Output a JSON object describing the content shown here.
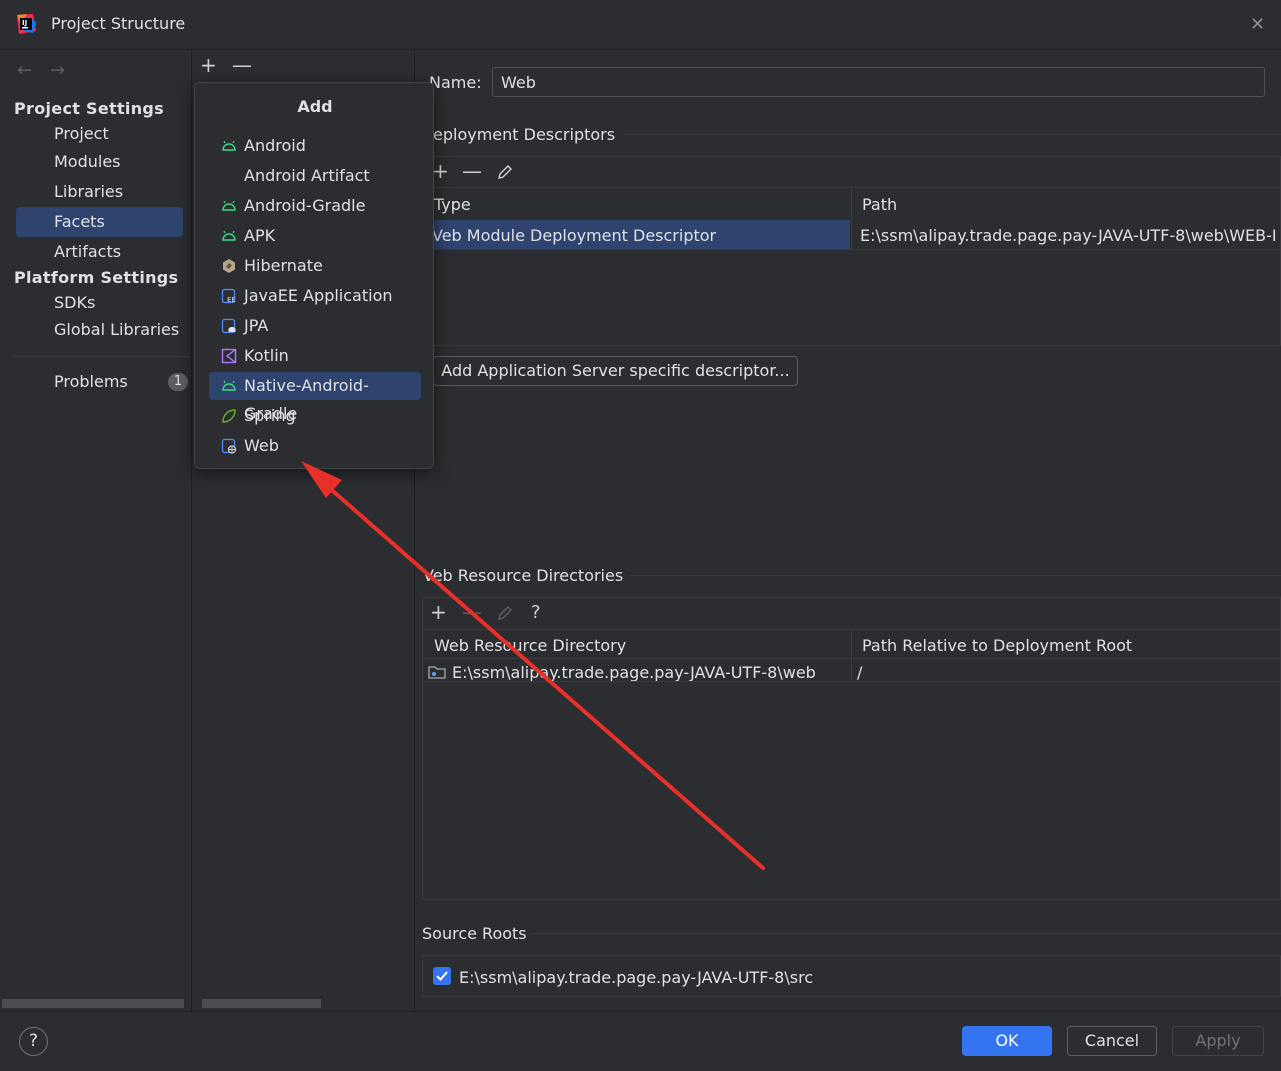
{
  "window": {
    "title": "Project Structure"
  },
  "sidebar": {
    "project_settings_label": "Project Settings",
    "project_items": [
      "Project",
      "Modules",
      "Libraries",
      "Facets",
      "Artifacts"
    ],
    "platform_settings_label": "Platform Settings",
    "platform_items": [
      "SDKs",
      "Global Libraries"
    ],
    "problems_label": "Problems",
    "problems_count": "1"
  },
  "popup": {
    "title": "Add",
    "items": [
      {
        "label": "Android",
        "icon": "android-icon"
      },
      {
        "label": "Android Artifact",
        "icon": ""
      },
      {
        "label": "Android-Gradle",
        "icon": "android-icon"
      },
      {
        "label": "APK",
        "icon": "android-icon"
      },
      {
        "label": "Hibernate",
        "icon": "hibernate-icon"
      },
      {
        "label": "JavaEE Application",
        "icon": "javaee-icon"
      },
      {
        "label": "JPA",
        "icon": "jpa-icon"
      },
      {
        "label": "Kotlin",
        "icon": "kotlin-icon"
      },
      {
        "label": "Native-Android-Gradle",
        "icon": "android-icon"
      },
      {
        "label": "Spring",
        "icon": "spring-icon"
      },
      {
        "label": "Web",
        "icon": "web-icon"
      }
    ],
    "selected": "Native-Android-Gradle"
  },
  "main": {
    "name_label": "Name:",
    "name_value": "Web",
    "deployment_title": "eployment Descriptors",
    "deployment_columns": [
      "Type",
      "Path"
    ],
    "deployment_row": {
      "type": "Veb Module Deployment Descriptor",
      "path": "E:\\ssm\\alipay.trade.page.pay-JAVA-UTF-8\\web\\WEB-I"
    },
    "add_server_button": "Add Application Server specific descriptor...",
    "web_resource_title": "Veb Resource Directories",
    "web_resource_columns": [
      "Web Resource Directory",
      "Path Relative to Deployment Root"
    ],
    "web_resource_row": {
      "dir": "E:\\ssm\\alipay.trade.page.pay-JAVA-UTF-8\\web",
      "path": "/"
    },
    "source_roots_title": "Source Roots",
    "source_root": "E:\\ssm\\alipay.trade.page.pay-JAVA-UTF-8\\src"
  },
  "footer": {
    "help": "?",
    "ok": "OK",
    "cancel": "Cancel",
    "apply": "Apply"
  },
  "colors": {
    "accent": "#3574f0",
    "selection": "#2e436e",
    "background": "#2b2d30",
    "arrow": "#e8302a"
  }
}
